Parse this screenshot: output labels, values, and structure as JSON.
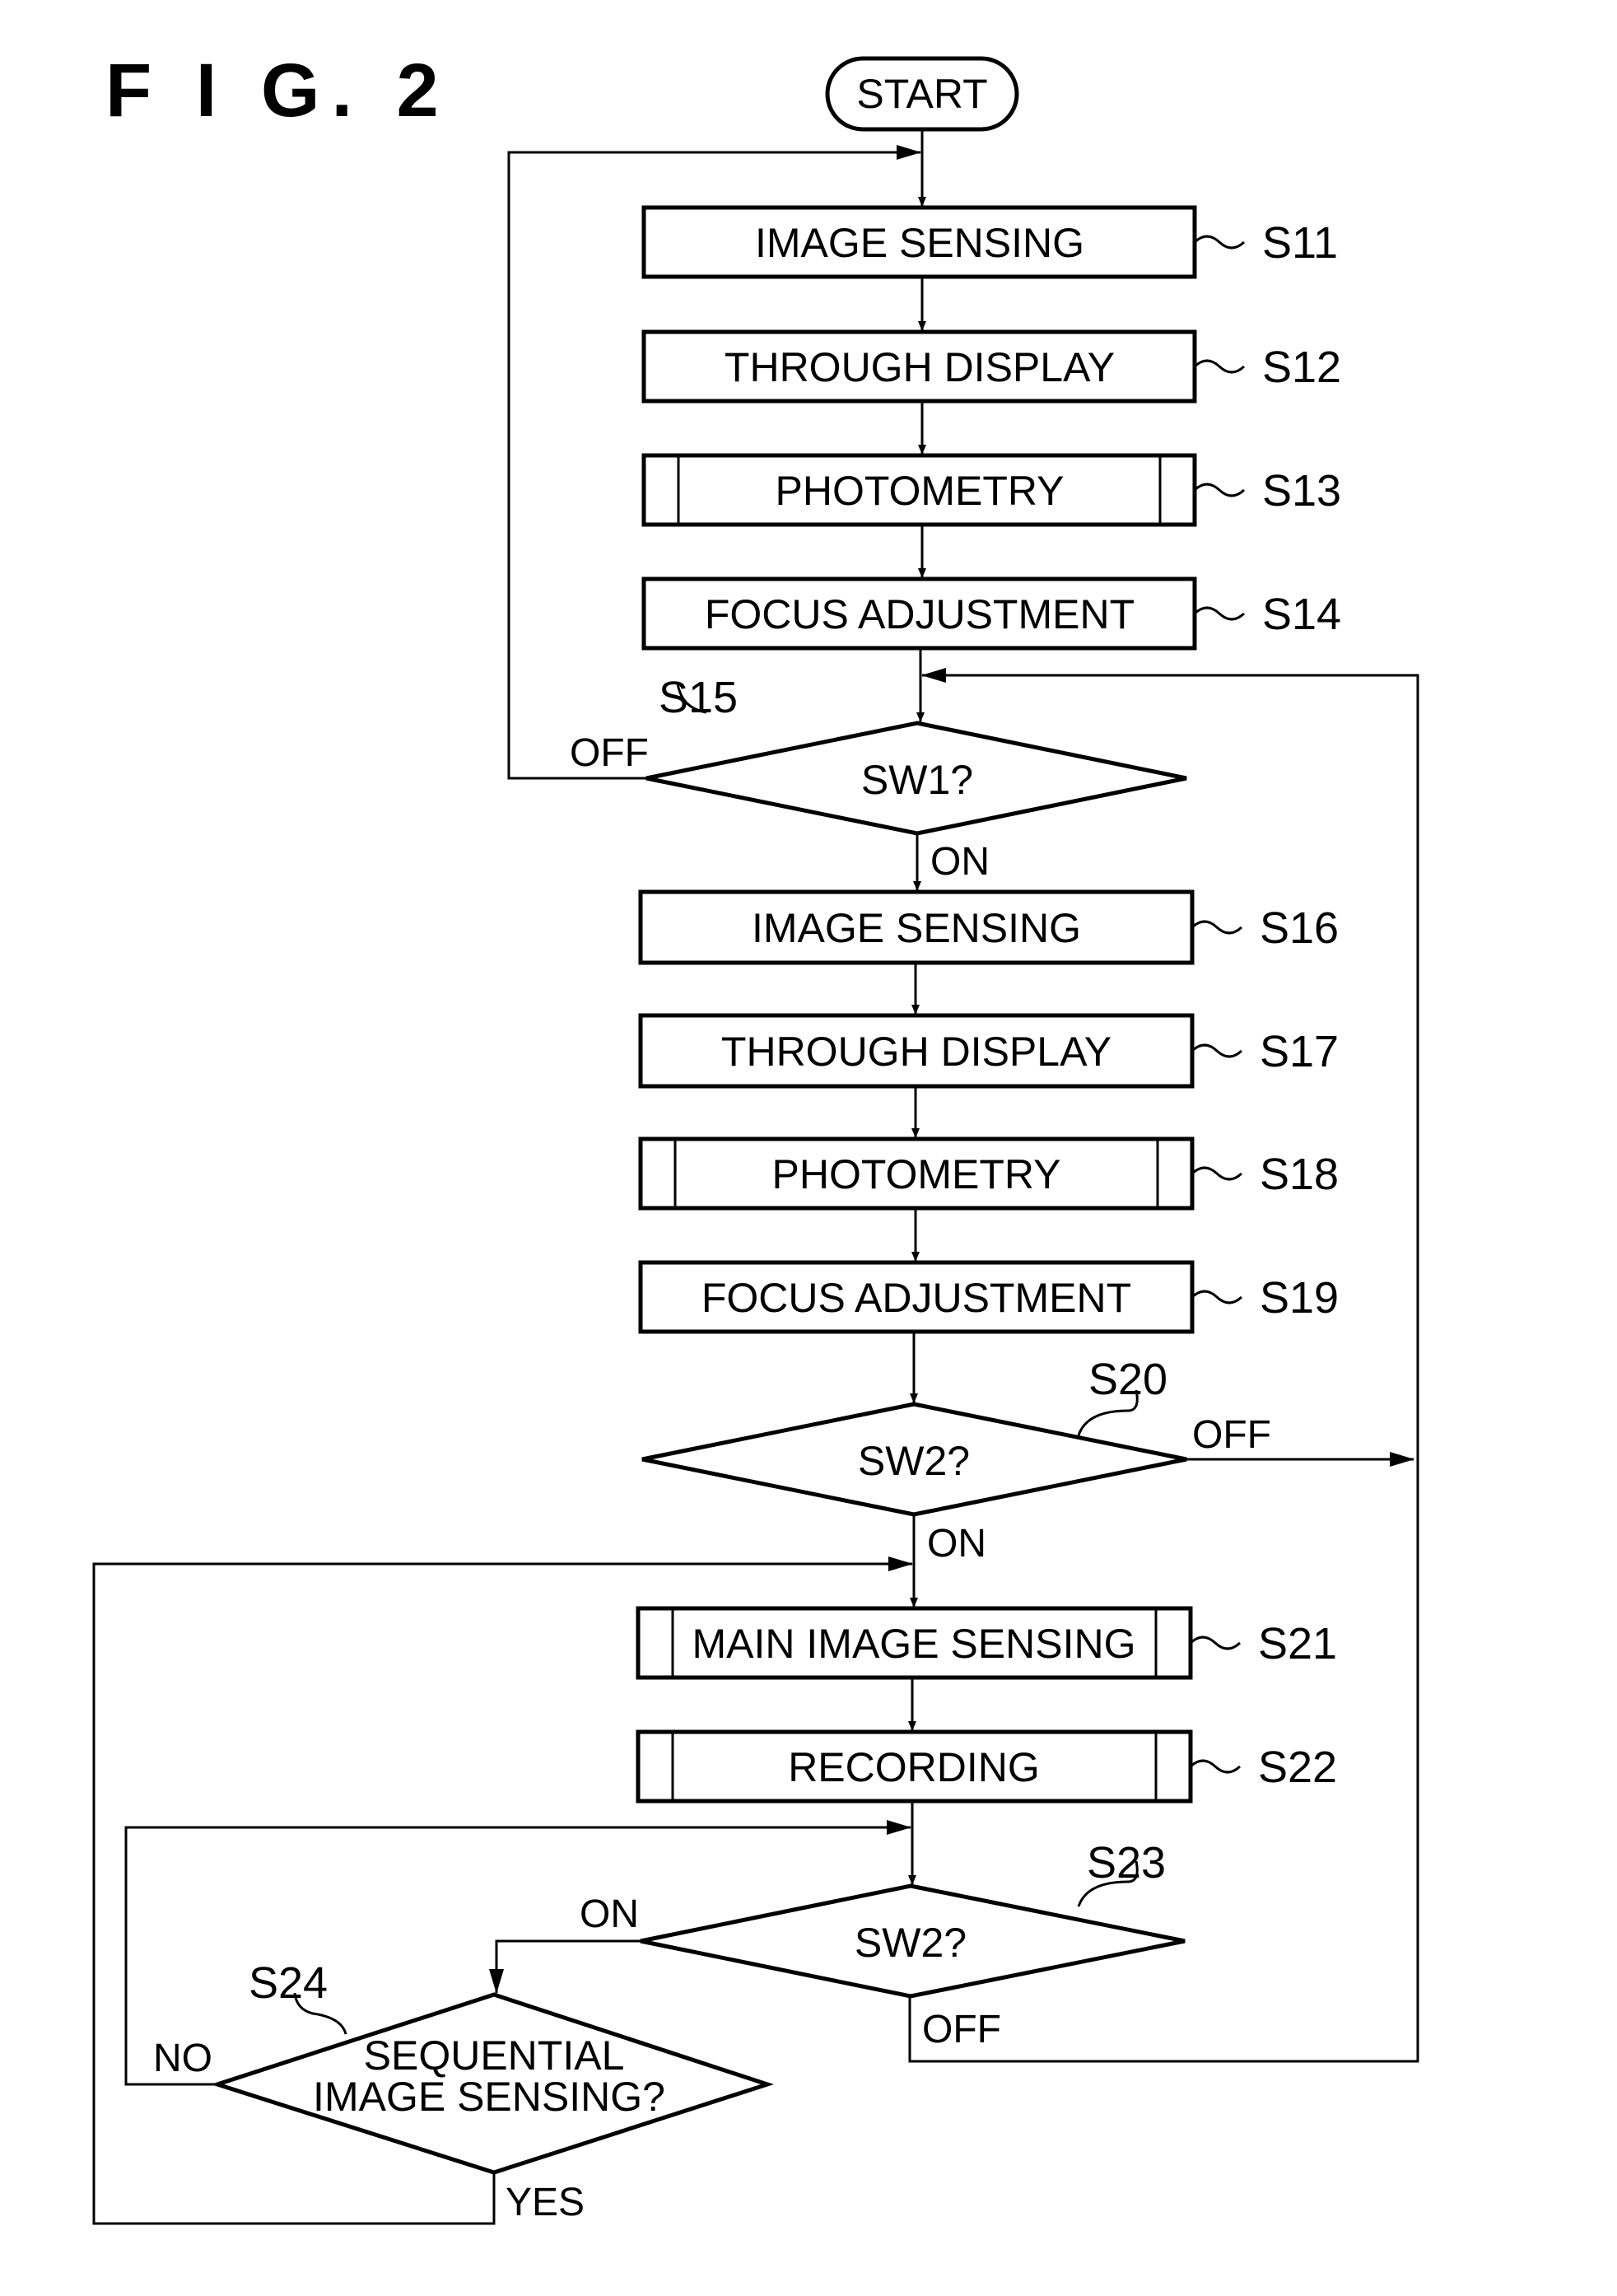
{
  "figure": {
    "title": "F I G. 2"
  },
  "start": {
    "label": "START"
  },
  "steps": {
    "s11": {
      "id": "S11",
      "label": "IMAGE SENSING",
      "type": "process"
    },
    "s12": {
      "id": "S12",
      "label": "THROUGH DISPLAY",
      "type": "process"
    },
    "s13": {
      "id": "S13",
      "label": "PHOTOMETRY",
      "type": "subroutine"
    },
    "s14": {
      "id": "S14",
      "label": "FOCUS ADJUSTMENT",
      "type": "process"
    },
    "s15": {
      "id": "S15",
      "label": "SW1?",
      "type": "decision"
    },
    "s16": {
      "id": "S16",
      "label": "IMAGE SENSING",
      "type": "process"
    },
    "s17": {
      "id": "S17",
      "label": "THROUGH DISPLAY",
      "type": "process"
    },
    "s18": {
      "id": "S18",
      "label": "PHOTOMETRY",
      "type": "subroutine"
    },
    "s19": {
      "id": "S19",
      "label": "FOCUS ADJUSTMENT",
      "type": "process"
    },
    "s20": {
      "id": "S20",
      "label": "SW2?",
      "type": "decision"
    },
    "s21": {
      "id": "S21",
      "label": "MAIN IMAGE SENSING",
      "type": "subroutine"
    },
    "s22": {
      "id": "S22",
      "label": "RECORDING",
      "type": "subroutine"
    },
    "s23": {
      "id": "S23",
      "label": "SW2?",
      "type": "decision"
    },
    "s24": {
      "id": "S24",
      "label_line1": "SEQUENTIAL",
      "label_line2": "IMAGE SENSING?",
      "type": "decision"
    }
  },
  "branches": {
    "s15_off": "OFF",
    "s15_on": "ON",
    "s20_off": "OFF",
    "s20_on": "ON",
    "s23_on": "ON",
    "s23_off": "OFF",
    "s24_no": "NO",
    "s24_yes": "YES"
  }
}
